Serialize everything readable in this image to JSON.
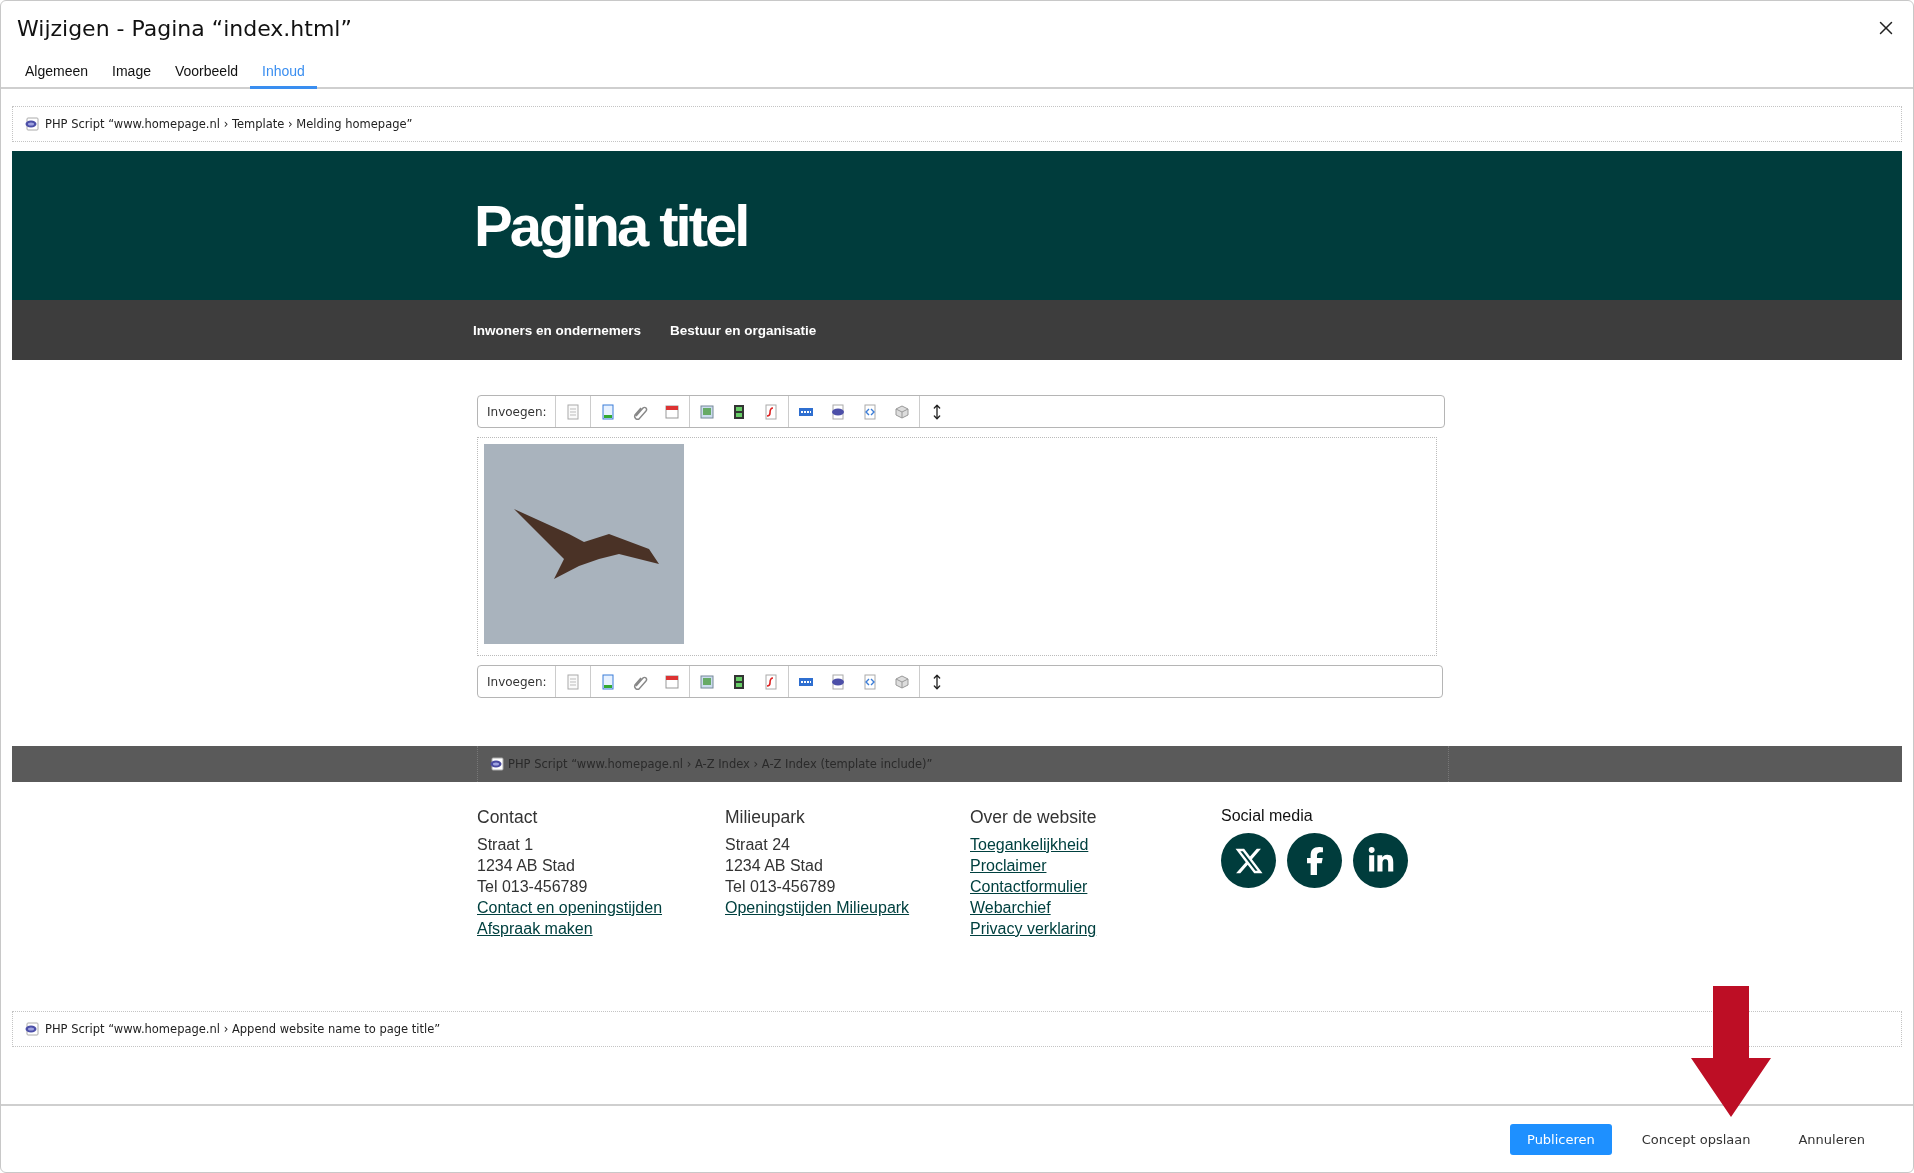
{
  "window": {
    "title": "Wijzigen - Pagina “index.html”"
  },
  "tabs": [
    {
      "label": "Algemeen",
      "selected": false
    },
    {
      "label": "Image",
      "selected": false
    },
    {
      "label": "Voorbeeld",
      "selected": false
    },
    {
      "label": "Inhoud",
      "selected": true
    }
  ],
  "top_script": {
    "text": "PHP Script “www.homepage.nl › Template › Melding homepage”"
  },
  "page_header": {
    "title": "Pagina titel"
  },
  "nav": [
    "Inwoners en ondernemers",
    "Bestuur en organisatie"
  ],
  "toolbars": [
    {
      "label": "Invoegen:"
    },
    {
      "label": "Invoegen:"
    }
  ],
  "include_bar": {
    "text": "PHP Script “www.homepage.nl › A-Z Index › A-Z Index (template include)”"
  },
  "footer_columns": [
    {
      "heading": "Contact",
      "lines": [
        {
          "kind": "text",
          "text": "Straat 1"
        },
        {
          "kind": "text",
          "text": "1234 AB  Stad"
        },
        {
          "kind": "text",
          "text": "Tel 013-456789"
        },
        {
          "kind": "link",
          "text": "Contact en openingstijden"
        },
        {
          "kind": "link",
          "text": "Afspraak maken"
        }
      ]
    },
    {
      "heading": "Milieupark",
      "lines": [
        {
          "kind": "text",
          "text": "Straat 24"
        },
        {
          "kind": "text",
          "text": "1234 AB  Stad"
        },
        {
          "kind": "text",
          "text": "Tel 013-456789"
        },
        {
          "kind": "link",
          "text": "Openingstijden Milieupark"
        }
      ]
    },
    {
      "heading": "Over de website",
      "lines": [
        {
          "kind": "link",
          "text": "Toegankelijkheid"
        },
        {
          "kind": "link",
          "text": "Proclaimer"
        },
        {
          "kind": "link",
          "text": "Contactformulier"
        },
        {
          "kind": "link",
          "text": "Webarchief"
        },
        {
          "kind": "link",
          "text": "Privacy verklaring"
        }
      ]
    }
  ],
  "social": {
    "heading": "Social media",
    "icons": [
      {
        "kind": "x"
      },
      {
        "kind": "facebook"
      },
      {
        "kind": "linkedin"
      }
    ]
  },
  "bottom_script": {
    "text": "PHP Script “www.homepage.nl › Append website name to page title”"
  },
  "buttons": [
    {
      "label": "Publiceren",
      "kind": "primary"
    },
    {
      "label": "Concept opslaan",
      "kind": "plain"
    },
    {
      "label": "Annuleren",
      "kind": "plain"
    }
  ]
}
